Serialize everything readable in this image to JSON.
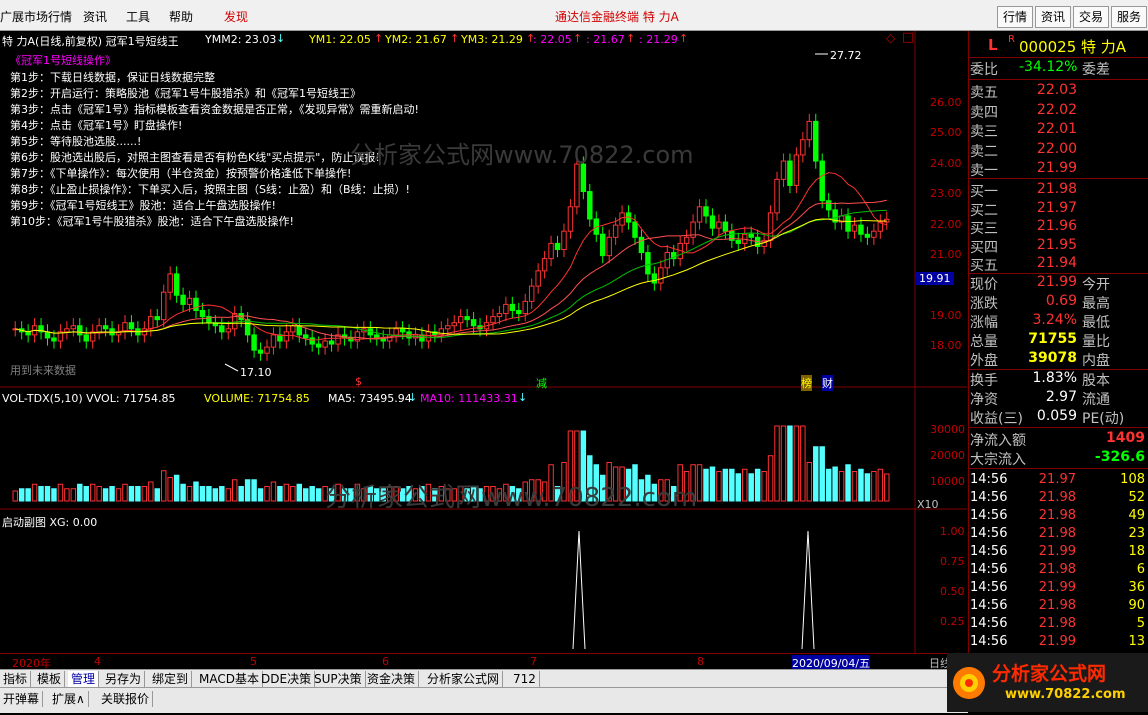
{
  "menu": {
    "items": [
      "广展市场行情",
      "资讯",
      "工具",
      "帮助",
      "发现"
    ],
    "center_title": "通达信金融终端  特 力A",
    "right_buttons": [
      "行情",
      "资讯",
      "交易",
      "服务"
    ]
  },
  "header": {
    "stock_title": "特 力A(日线,前复权) 冠军1号短线王",
    "ymm2": "YMM2: 23.03",
    "ym1": "YM1: 22.05",
    "ym2": "YM2: 21.67",
    "ym3": "YM3: 21.29",
    "extra1": ": 22.05",
    "extra2": ": 21.67",
    "extra3": ": 21.29"
  },
  "steps": {
    "title": "《冠军1号短线操作》",
    "lines": [
      "第1步：下载日线数据，保证日线数据完整",
      "第2步：开启运行：策略股池《冠军1号牛股猎杀》和《冠军1号短线王》",
      "第3步：点击《冠军1号》指标模板查看资金数据是否正常，《发现异常》需重新启动!",
      "第4步：点击《冠军1号》盯盘操作!",
      "第5步：等待股池选股......!",
      "第6步：股池选出股后，对照主图查看是否有粉色K线\"买点提示\"，防止误报!",
      "第7步：《下单操作》：每次使用（半仓资金）按预警价格逢低下单操作!",
      "第8步：《止盈止损操作》：下单买入后，按照主图（S线：止盈）和（B线：止损）!",
      "第9步：《冠军1号短线王》股池：适合上午盘选股操作!",
      "第10步：《冠军1号牛股猎杀》股池：适合下午盘选股操作!"
    ]
  },
  "price_axis": [
    "26.00",
    "25.00",
    "24.00",
    "23.00",
    "22.00",
    "21.00",
    "19.91",
    "19.00",
    "18.00"
  ],
  "annotations": {
    "high": "27.72",
    "low": "17.10",
    "future": "用到未来数据",
    "marker_s": "$",
    "marker_jian": "减",
    "marker_bang": "榜",
    "marker_cai": "财",
    "watermark1": "分析家公式网www.70822.com",
    "watermark2": "分析家公式网www.70822.com"
  },
  "volume": {
    "header": "VOL-TDX(5,10)  VVOL: 71754.85",
    "volume": "VOLUME: 71754.85",
    "ma5": "MA5: 73495.94",
    "ma10": "MA10: 111433.31",
    "axis": [
      "30000",
      "20000",
      "10000"
    ],
    "unit": "X10"
  },
  "subchart": {
    "header": "启动副图  XG: 0.00",
    "axis": [
      "1.00",
      "0.75",
      "0.50",
      "0.25"
    ]
  },
  "dates": [
    "2020年",
    "4",
    "5",
    "6",
    "7",
    "8",
    "2020/09/04/五"
  ],
  "day_label": "日线",
  "quote": {
    "code_label": "L",
    "code_r": "R",
    "code": "000025 特 力A",
    "weibi_label": "委比",
    "weibi": "-34.12%",
    "weicha_label": "委差",
    "sell": [
      {
        "label": "卖五",
        "price": "22.03"
      },
      {
        "label": "卖四",
        "price": "22.02"
      },
      {
        "label": "卖三",
        "price": "22.01"
      },
      {
        "label": "卖二",
        "price": "22.00"
      },
      {
        "label": "卖一",
        "price": "21.99"
      }
    ],
    "buy": [
      {
        "label": "买一",
        "price": "21.98"
      },
      {
        "label": "买二",
        "price": "21.97"
      },
      {
        "label": "买三",
        "price": "21.96"
      },
      {
        "label": "买四",
        "price": "21.95"
      },
      {
        "label": "买五",
        "price": "21.94"
      }
    ],
    "stats": [
      {
        "label": "现价",
        "value": "21.99",
        "label2": "今开"
      },
      {
        "label": "涨跌",
        "value": "0.69",
        "label2": "最高"
      },
      {
        "label": "涨幅",
        "value": "3.24%",
        "label2": "最低"
      },
      {
        "label": "总量",
        "value": "71755",
        "label2": "量比"
      },
      {
        "label": "外盘",
        "value": "39078",
        "label2": "内盘"
      }
    ],
    "stats2": [
      {
        "label": "换手",
        "value": "1.83%",
        "label2": "股本"
      },
      {
        "label": "净资",
        "value": "2.97",
        "label2": "流通"
      },
      {
        "label": "收益(三)",
        "value": "0.059",
        "label2": "PE(动)"
      }
    ],
    "flow": [
      {
        "label": "净流入额",
        "value": "1409"
      },
      {
        "label": "大宗流入",
        "value": "-326.6"
      }
    ],
    "trades": [
      {
        "time": "14:56",
        "price": "21.97",
        "vol": "108"
      },
      {
        "time": "14:56",
        "price": "21.98",
        "vol": "52"
      },
      {
        "time": "14:56",
        "price": "21.98",
        "vol": "49"
      },
      {
        "time": "14:56",
        "price": "21.98",
        "vol": "23"
      },
      {
        "time": "14:56",
        "price": "21.99",
        "vol": "18"
      },
      {
        "time": "14:56",
        "price": "21.98",
        "vol": "6"
      },
      {
        "time": "14:56",
        "price": "21.99",
        "vol": "36"
      },
      {
        "time": "14:56",
        "price": "21.98",
        "vol": "90"
      },
      {
        "time": "14:56",
        "price": "21.98",
        "vol": "5"
      },
      {
        "time": "14:56",
        "price": "21.99",
        "vol": "13"
      }
    ]
  },
  "bottom_tabs": [
    "指标",
    "模板",
    "管理",
    "另存为",
    "绑定到",
    "MACD基本",
    "DDE决策",
    "SUP决策",
    "资金决策",
    "分析家公式网",
    "712"
  ],
  "bottom_tabs2": [
    "开弹幕",
    "扩展∧",
    "关联报价"
  ],
  "logo": {
    "name": "分析家公式网",
    "url": "www.70822.com"
  },
  "colors": {
    "up": "#ff3232",
    "down": "#54ffff",
    "green_candle": "#00ff00",
    "ma_yellow": "#ffff00",
    "ma_magenta": "#ff00ff"
  }
}
